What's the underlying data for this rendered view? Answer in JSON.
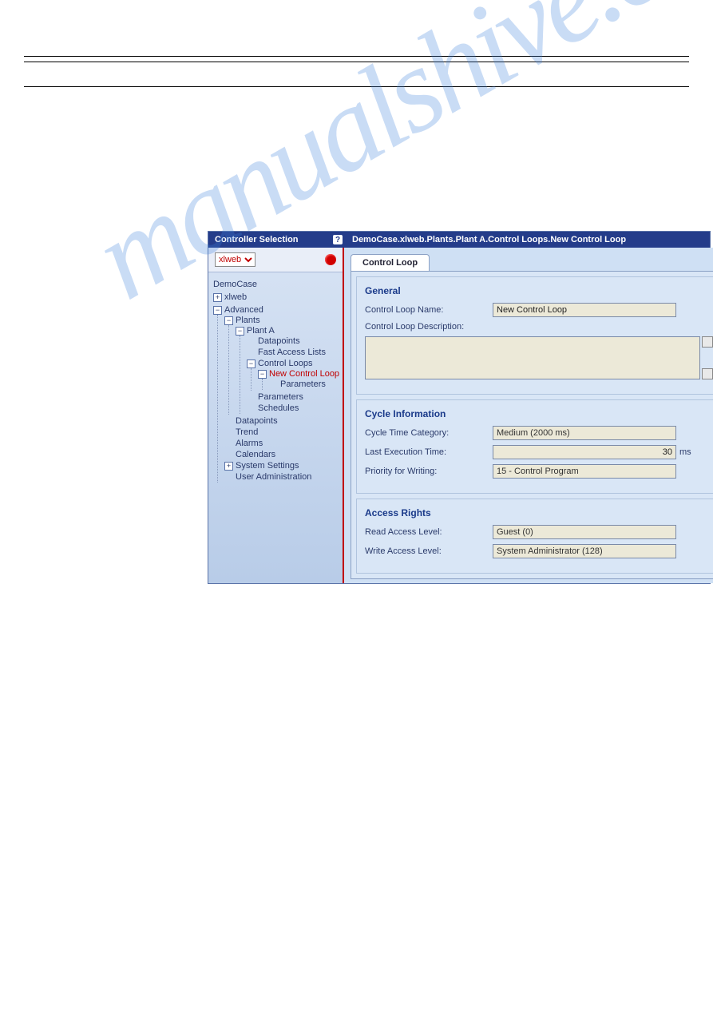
{
  "watermark": "manualshive.com",
  "titlebar": {
    "left_label": "Controller Selection",
    "help_glyph": "?",
    "breadcrumb": "DemoCase.xlweb.Plants.Plant A.Control Loops.New Control Loop"
  },
  "controller_dropdown": {
    "selected": "xlweb"
  },
  "tree": {
    "root": "DemoCase",
    "n1": {
      "toggle": "+",
      "label": "xlweb"
    },
    "n2": {
      "toggle": "−",
      "label": "Advanced"
    },
    "n2_1": {
      "toggle": "−",
      "label": "Plants"
    },
    "n2_1_1": {
      "toggle": "−",
      "label": "Plant A"
    },
    "n2_1_1_a": "Datapoints",
    "n2_1_1_b": "Fast Access Lists",
    "n2_1_1_c": {
      "toggle": "−",
      "label": "Control Loops"
    },
    "n2_1_1_c_1": {
      "toggle": "−",
      "label": "New Control Loop"
    },
    "n2_1_1_c_1_a": "Parameters",
    "n2_1_1_d": "Parameters",
    "n2_1_1_e": "Schedules",
    "n2_2": "Datapoints",
    "n2_3": "Trend",
    "n2_4": "Alarms",
    "n2_5": "Calendars",
    "n2_6": {
      "toggle": "+",
      "label": "System Settings"
    },
    "n2_7": "User Administration"
  },
  "tab": {
    "label": "Control Loop"
  },
  "section_general": {
    "title": "General",
    "name_label": "Control Loop Name:",
    "name_value": "New Control Loop",
    "desc_label": "Control Loop Description:",
    "desc_value": ""
  },
  "section_cycle": {
    "title": "Cycle Information",
    "cat_label": "Cycle Time Category:",
    "cat_value": "Medium (2000 ms)",
    "last_label": "Last Execution Time:",
    "last_value": "30",
    "last_unit": "ms",
    "prio_label": "Priority for Writing:",
    "prio_value": "15 - Control Program"
  },
  "section_access": {
    "title": "Access Rights",
    "read_label": "Read Access Level:",
    "read_value": "Guest (0)",
    "write_label": "Write Access Level:",
    "write_value": "System Administrator (128)"
  }
}
